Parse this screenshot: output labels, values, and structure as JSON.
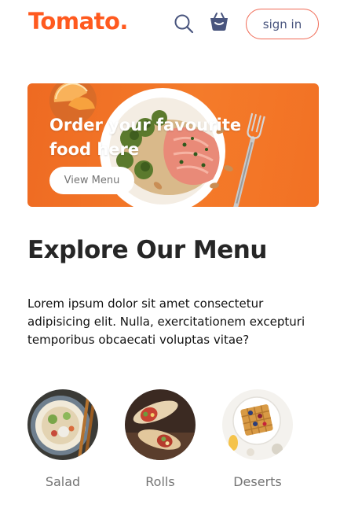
{
  "navbar": {
    "logo": "Tomato.",
    "search_icon": "search-icon",
    "basket_icon": "basket-icon",
    "signin_label": "sign in",
    "accent_color": "#ff5a1f"
  },
  "hero": {
    "title": "Order your favourite food here",
    "button_label": "View Menu",
    "background_color": "#f47b2a"
  },
  "explore": {
    "title": "Explore Our Menu",
    "description": "Lorem ipsum dolor sit amet consectetur adipisicing elit. Nulla, exercitationem excepturi temporibus obcaecati voluptas vitae?"
  },
  "menu": {
    "items": [
      {
        "label": "Salad"
      },
      {
        "label": "Rolls"
      },
      {
        "label": "Deserts"
      }
    ]
  }
}
